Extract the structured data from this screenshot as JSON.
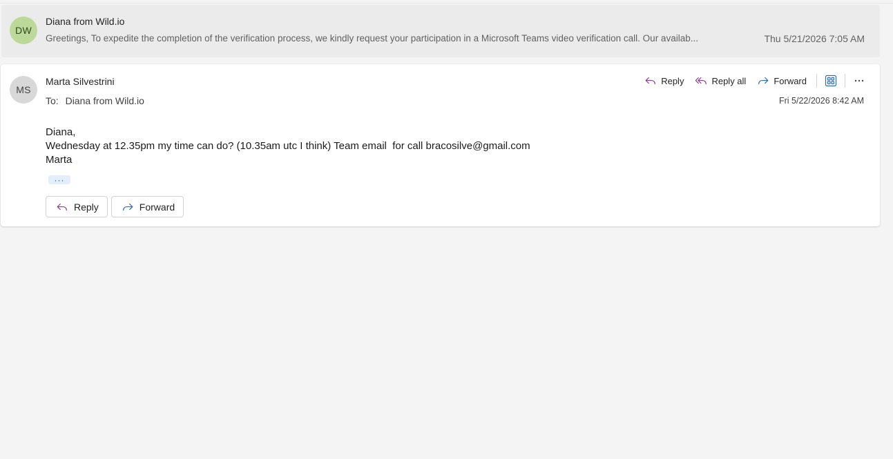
{
  "colors": {
    "reply_icon": "#8a3c8e",
    "forward_icon": "#2b6cb0",
    "avatar_dw": "#bcd99a",
    "avatar_ms": "#d8d8d8"
  },
  "collapsed_message": {
    "avatar_initials": "DW",
    "sender": "Diana from Wild.io",
    "preview": "Greetings, To expedite the completion of the verification process, we kindly request your participation in a Microsoft Teams video verification call. Our availab...",
    "date": "Thu 5/21/2026 7:05 AM"
  },
  "expanded_message": {
    "avatar_initials": "MS",
    "sender": "Marta Silvestrini",
    "to_label": "To:",
    "to_value": "Diana from Wild.io",
    "date": "Fri 5/22/2026 8:42 AM",
    "actions": {
      "reply": "Reply",
      "reply_all": "Reply all",
      "forward": "Forward",
      "apps_icon": "apps-grid-icon",
      "more_icon": "more-horizontal-icon"
    },
    "body_lines": [
      "Diana,",
      "Wednesday at 12.35pm my time can do? (10.35am utc I think) Team email  for call bracosilve@gmail.com",
      "Marta"
    ],
    "show_more": "···",
    "bottom_buttons": {
      "reply": "Reply",
      "forward": "Forward"
    }
  }
}
